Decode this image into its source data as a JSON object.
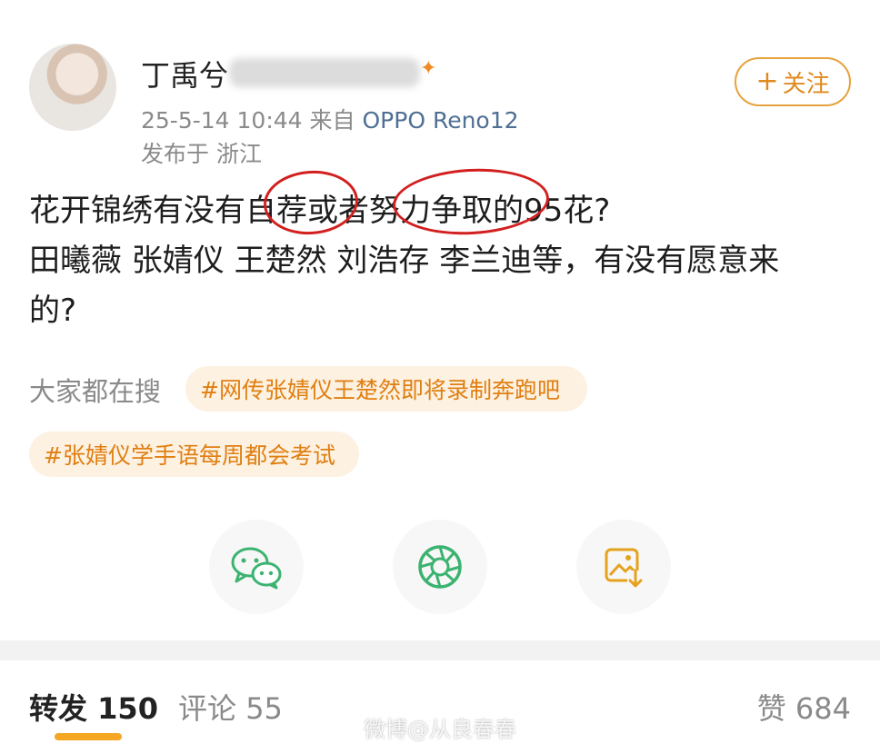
{
  "post": {
    "username": "丁禹兮",
    "timestamp": "25-5-14 10:44",
    "source_prefix": "来自",
    "device": "OPPO Reno12",
    "location": "发布于 浙江",
    "follow_label": "关注",
    "content_lines": [
      "花开锦绣有没有自荐或者努力争取的95花?",
      "田曦薇 张婧仪 王楚然 刘浩存 李兰迪等，有没有愿意来",
      "的?"
    ]
  },
  "search": {
    "label": "大家都在搜",
    "tags": [
      "#网传张婧仪王楚然即将录制奔跑吧",
      "#张婧仪学手语每周都会考试"
    ]
  },
  "share": {
    "icons": [
      "wechat-icon",
      "moments-icon",
      "save-image-icon"
    ],
    "colors": {
      "wechat": "#3cb371",
      "moments": "#3cb371",
      "save": "#e5a21d"
    }
  },
  "tabs": {
    "forward_label": "转发",
    "forward_count": "150",
    "comment_label": "评论",
    "comment_count": "55",
    "like_label": "赞",
    "like_count": "684"
  },
  "watermark": "微博@从良春春",
  "colors": {
    "accent": "#f5a623",
    "follow": "#e08a1e",
    "tag_bg": "#fdf1e1",
    "tag_text": "#e07f12",
    "annotation": "#d21f1f"
  }
}
